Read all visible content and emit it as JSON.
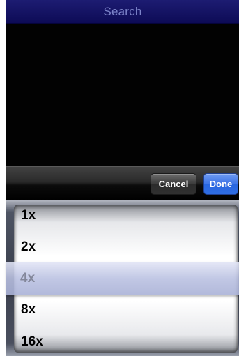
{
  "title_bar": {
    "title": "Search"
  },
  "toolbar": {
    "cancel_label": "Cancel",
    "done_label": "Done"
  },
  "picker": {
    "options": [
      "1x",
      "2x",
      "4x",
      "8x",
      "16x"
    ],
    "selected": "4x"
  },
  "colors": {
    "title_bar": "#120f63",
    "title_text": "#7c83c9",
    "done_button": "#3b73e6",
    "cancel_button": "#4a4a4a",
    "content_background": "#020202"
  }
}
